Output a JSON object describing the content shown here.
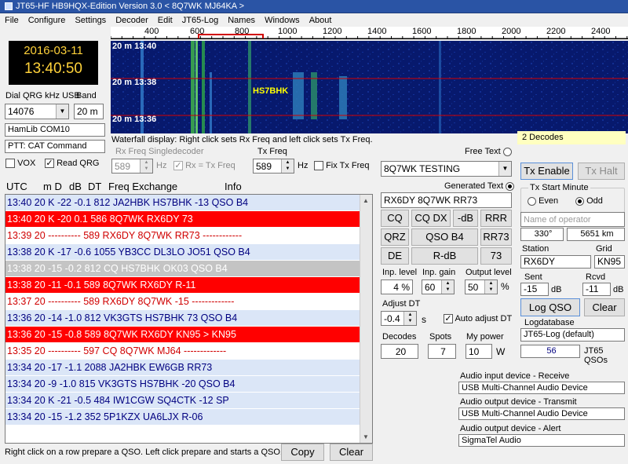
{
  "window": {
    "title": "JT65-HF HB9HQX-Edition Version 3.0   < 8Q7WK MJ64KA >"
  },
  "menu": [
    "File",
    "Configure",
    "Settings",
    "Decoder",
    "Edit",
    "JT65-Log",
    "Names",
    "Windows",
    "About"
  ],
  "clock": {
    "date": "2016-03-11",
    "time": "13:40:50"
  },
  "dial": {
    "label": "Dial QRG kHz USB",
    "value": "14076",
    "band_label": "Band",
    "band": "20 m"
  },
  "hamlib": "HamLib COM10",
  "ptt": "PTT: CAT Command",
  "vox": {
    "label": "VOX",
    "checked": false
  },
  "readqrg": {
    "label": "Read QRG",
    "checked": true
  },
  "ruler": {
    "ticks": [
      "400",
      "600",
      "800",
      "1000",
      "1200",
      "1400",
      "1600",
      "1800",
      "2000",
      "2200",
      "2400"
    ]
  },
  "waterfall": {
    "lines": [
      "20 m 13:40",
      "20 m 13:38",
      "20 m 13:36"
    ],
    "callsign": "HS7BHK",
    "hint": "Waterfall display: Right click sets Rx Freq and left click sets Tx Freq.",
    "decodes": "2 Decodes"
  },
  "rx": {
    "label": "Rx Freq Singledecoder",
    "value": "589",
    "unit": "Hz",
    "eq_label": "Rx = Tx Freq"
  },
  "tx": {
    "label": "Tx Freq",
    "value": "589",
    "unit": "Hz",
    "fix_label": "Fix Tx Freq"
  },
  "freetext": {
    "label": "Free Text",
    "value": "8Q7WK TESTING"
  },
  "generated": {
    "label": "Generated Text",
    "value": "RX6DY 8Q7WK RR73"
  },
  "msgbuttons": [
    "CQ",
    "CQ DX",
    "-dB",
    "RRR",
    "QRZ",
    "QSO B4",
    "RR73",
    "DE",
    "R-dB",
    "73"
  ],
  "levels": {
    "inp_label": "Inp. level",
    "inp": "4",
    "inp_unit": "%",
    "gain_label": "Inp. gain",
    "gain": "60",
    "out_label": "Output level",
    "out": "50",
    "out_unit": "%"
  },
  "adjust": {
    "label": "Adjust DT",
    "value": "-0.4",
    "unit": "s",
    "auto_label": "Auto adjust DT",
    "auto_checked": true
  },
  "stats": {
    "decodes_label": "Decodes",
    "decodes": "20",
    "spots_label": "Spots",
    "spots": "7",
    "power_label": "My power",
    "power": "10",
    "power_unit": "W"
  },
  "txctl": {
    "enable": "Tx Enable",
    "halt": "Tx Halt",
    "start_label": "Tx Start Minute",
    "even": "Even",
    "odd": "Odd"
  },
  "operator": {
    "placeholder": "Name of operator",
    "bearing": "330°",
    "distance": "5651 km",
    "station_label": "Station",
    "station": "RX6DY",
    "grid_label": "Grid",
    "grid": "KN95"
  },
  "report": {
    "sent_label": "Sent",
    "sent": "-15",
    "rcvd_label": "Rcvd",
    "rcvd": "-11",
    "unit": "dB"
  },
  "log": {
    "logqso": "Log QSO",
    "clear": "Clear",
    "db_label": "Logdatabase",
    "db": "JT65-Log (default)",
    "count": "56",
    "count_label": "JT65 QSOs"
  },
  "audio": {
    "in_label": "Audio input device - Receive",
    "in": "USB Multi-Channel Audio Device",
    "out_label": "Audio output device - Transmit",
    "out": "USB Multi-Channel Audio Device",
    "alert_label": "Audio output device - Alert",
    "alert": "SigmaTel Audio"
  },
  "list": {
    "headers": {
      "utc": "UTC",
      "mode": "m D",
      "db": "dB",
      "dt": "DT",
      "freq": "Freq Exchange",
      "info": "Info"
    },
    "rows": [
      {
        "text": "13:40  20 K -22 -0.1    812 JA2HBK HS7BHK -13          QSO B4",
        "style": "blue"
      },
      {
        "text": "13:40  20 K -20  0.1    586 8Q7WK RX6DY 73",
        "style": "red"
      },
      {
        "text": "13:39  20 ----------   589 RX6DY 8Q7WK RR73 ------------",
        "style": "white"
      },
      {
        "text": "13:38  20 K -17 -0.6  1055 YB3CC DL3LO JO51         QSO B4",
        "style": "blue"
      },
      {
        "text": "13:38  20    -15 -0.2    812 CQ HS7BHK OK03            QSO B4",
        "style": "gray"
      },
      {
        "text": "13:38  20    -11 -0.1    589 8Q7WK RX6DY R-11",
        "style": "red"
      },
      {
        "text": "13:37  20 ----------   589 RX6DY 8Q7WK -15 -------------",
        "style": "white"
      },
      {
        "text": "13:36  20    -14 -1.0    812 VK3GTS HS7BHK 73          QSO B4",
        "style": "blue"
      },
      {
        "text": "13:36  20    -15 -0.8    589 8Q7WK RX6DY KN95          > KN95",
        "style": "red"
      },
      {
        "text": "13:35  20 ----------   597 CQ 8Q7WK MJ64 -------------",
        "style": "white"
      },
      {
        "text": "13:34  20    -17 -1.1  2088 JA2HBK EW6GB RR73",
        "style": "blue"
      },
      {
        "text": "13:34  20      -9 -1.0    815 VK3GTS HS7BHK -20          QSO B4",
        "style": "blue"
      },
      {
        "text": "13:34  20 K -21 -0.5    484 IW1CGW SQ4CTK -12          SP",
        "style": "blue"
      },
      {
        "text": "13:34  20    -15 -1.2    352 5P1KZX UA6LJX R-06",
        "style": "blue"
      }
    ]
  },
  "footer": {
    "hint": "Right click on a row prepare a QSO. Left click prepare and starts a QSO.",
    "copy": "Copy",
    "clear": "Clear"
  }
}
